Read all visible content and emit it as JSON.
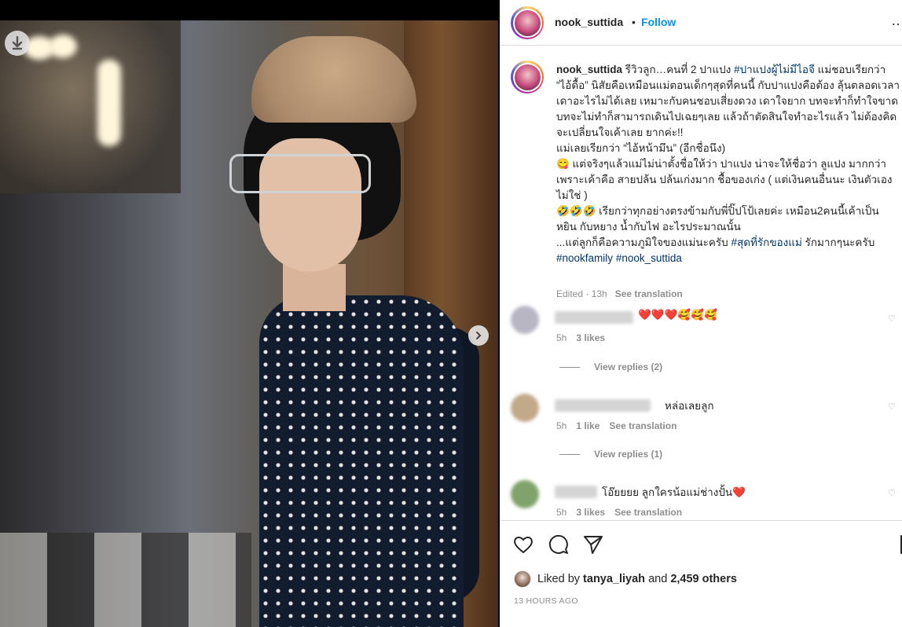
{
  "post": {
    "username": "nook_suttida",
    "follow_label": "Follow",
    "dot": "•",
    "more_glyph": "…",
    "caption": {
      "username": "nook_suttida",
      "text1": " รีวิวลูก…คนที่ 2 ปาแปง ",
      "tag1": "#ปาแปงผู้ไม่มีไอจี",
      "text2": " แม่ชอบเรียกว่า “ไอ้ดื้อ” นิสัยคือเหมือนแม่ตอนเด็กๆสุดที่คนนี้ กับปาแปงคือต้อง ลุ้นตลอดเวลา เดาอะไรไม่ได้เลย เหมาะกับคนชอบเสี่ยงดวง เดาใจยาก บทจะทำก็ทำใจขาด บทจะไม่ทำก็สามารถเดินไปเฉยๆเลย แล้วถ้าตัดสินใจทำอะไรแล้ว ไม่ต้องคิดจะเปลี่ยนใจเค้าเลย ยากค่ะ!!",
      "line2": "แม่เลยเรียกว่า “ไอ้หน้ามึน” (อีกชื่อนึง)",
      "line3": "😋 แต่จริงๆแล้วแม่ไม่น่าตั้งชื่อให้ว่า ปาแปง น่าจะให้ชื่อว่า ลูแปง มากกว่า เพราะเค้าคือ สายปล้น ปล้นเก่งมาก ชื้อของเก่ง ( แต่เงินคนอื่นนะ เงินตัวเองไม่ใช่ )",
      "line4": "🤣🤣🤣 เรียกว่าทุกอย่างตรงข้ามกับพี่ปิ๊ปโป้เลยค่ะ เหมือน2คนนี้เค้าเป็น หยิน กับหยาง น้ำกับไฟ อะไรประมาณนั้น",
      "line5a": "...แต่ลูกก็คือความภูมิใจของแม่นะครับ ",
      "tag2": "#สุดที่รักของแม่",
      "line5b": " รักมากๆนะครับ",
      "tag3": "#nookfamily",
      "tag4": "#nook_suttida",
      "edited": "Edited · 13h",
      "see_translation": "See translation"
    },
    "comments": [
      {
        "text": "❤️❤️❤️🥰🥰🥰",
        "time": "5h",
        "likes": "3 likes",
        "translation": "",
        "replies": "View replies (2)",
        "avatar_color": "#b9b6c4"
      },
      {
        "text": "หล่อเลยลูก",
        "time": "5h",
        "likes": "1 like",
        "translation": "See translation",
        "replies": "View replies (1)",
        "avatar_color": "#c2a98a"
      },
      {
        "text": "โอ๊ยยยย ลูกใครน้อแม่ช่างปั้น❤️",
        "time": "5h",
        "likes": "3 likes",
        "translation": "See translation",
        "replies": "",
        "avatar_color": "#7fa36b"
      }
    ],
    "actions": {
      "like_icon": "heart-icon",
      "comment_icon": "comment-icon",
      "share_icon": "share-icon",
      "save_icon": "bookmark-icon"
    },
    "liked_by": {
      "prefix": "Liked by ",
      "user": "tanya_liyah",
      "middle": " and ",
      "others": "2,459 others"
    },
    "time_ago": "13 HOURS AGO"
  },
  "media": {
    "download_icon": "download-icon",
    "next_icon": "chevron-right-icon"
  }
}
